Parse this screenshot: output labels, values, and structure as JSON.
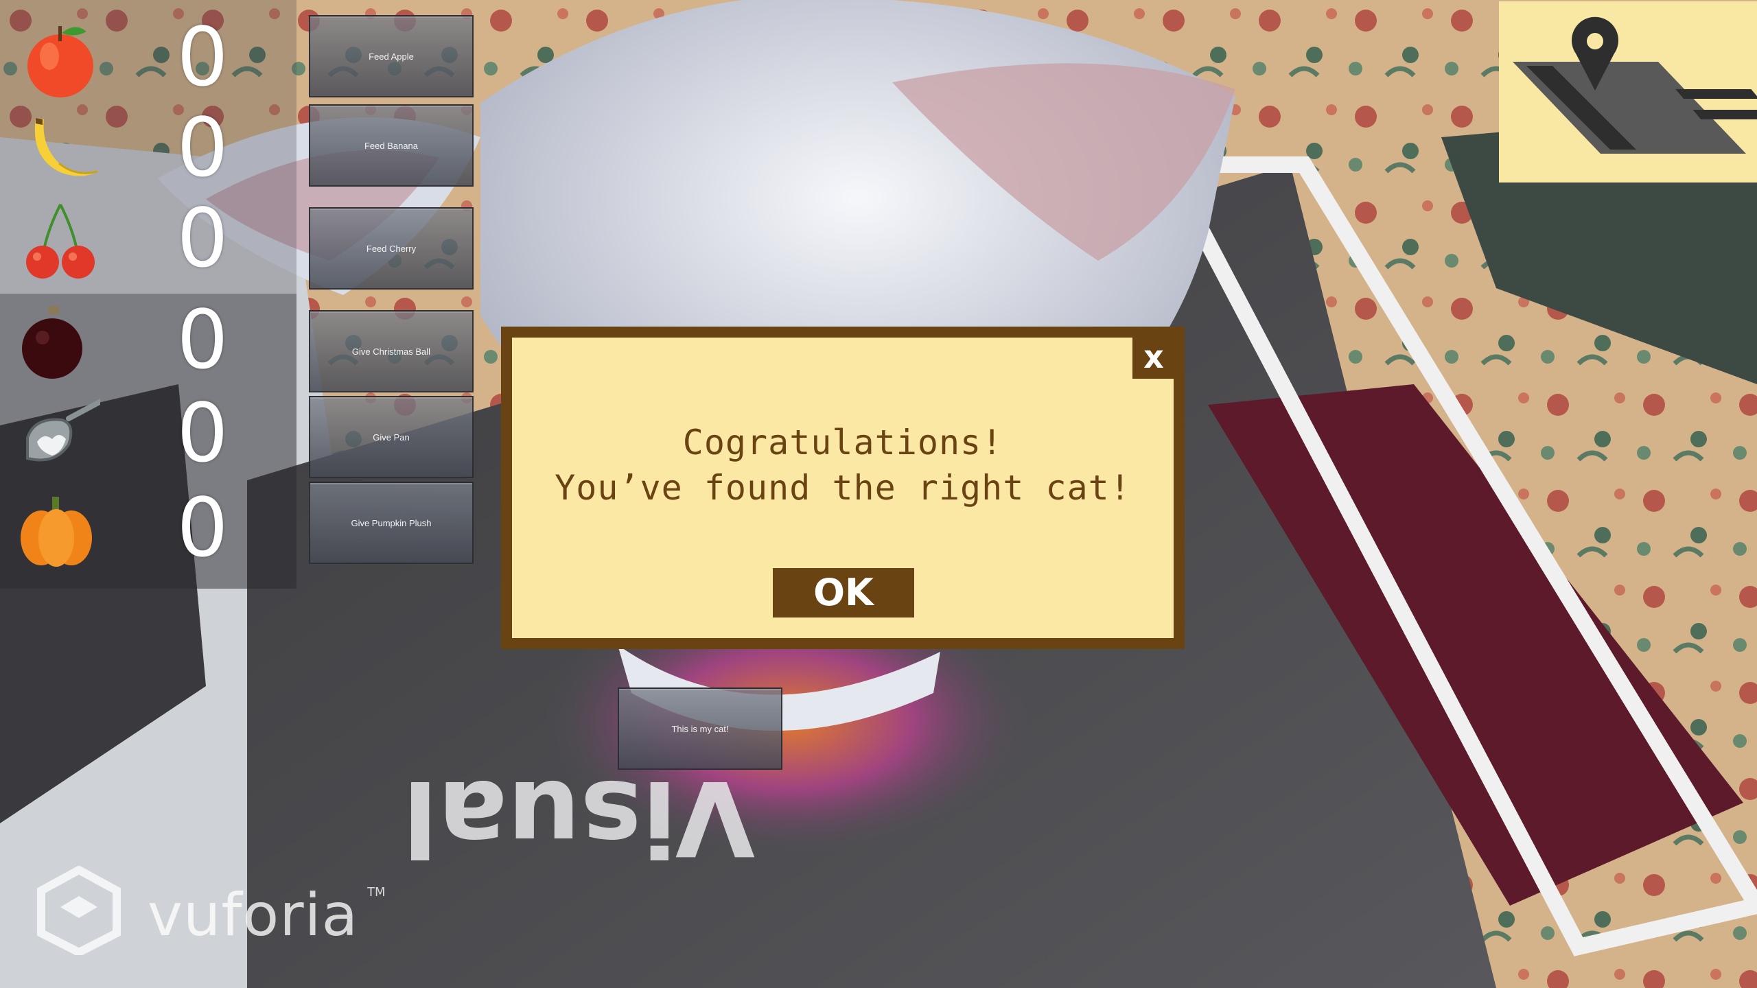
{
  "inventory": {
    "items": [
      {
        "icon": "apple-icon",
        "count": "0"
      },
      {
        "icon": "banana-icon",
        "count": "0"
      },
      {
        "icon": "cherry-icon",
        "count": "0"
      },
      {
        "icon": "christmas-ball-icon",
        "count": "0"
      },
      {
        "icon": "pan-icon",
        "count": "0"
      },
      {
        "icon": "pumpkin-icon",
        "count": "0"
      }
    ]
  },
  "actions": {
    "feed_apple": "Feed Apple",
    "feed_banana": "Feed Banana",
    "feed_cherry": "Feed Cherry",
    "give_christmas_ball": "Give Christmas Ball",
    "give_pan": "Give Pan",
    "give_pumpkin_plush": "Give Pumpkin Plush",
    "this_is_my_cat": "This is my cat!"
  },
  "map_button": {
    "icon": "map-pin-icon"
  },
  "dialog": {
    "line1": "Cogratulations!",
    "line2": "You’ve found the right cat!",
    "ok_label": "OK",
    "close_label": "x"
  },
  "watermark": {
    "text": "vuforia",
    "tm": "TM"
  },
  "colors": {
    "dialog_bg": "#fbe8a4",
    "dialog_border": "#6a4312",
    "map_bg": "#f8e8a4"
  }
}
